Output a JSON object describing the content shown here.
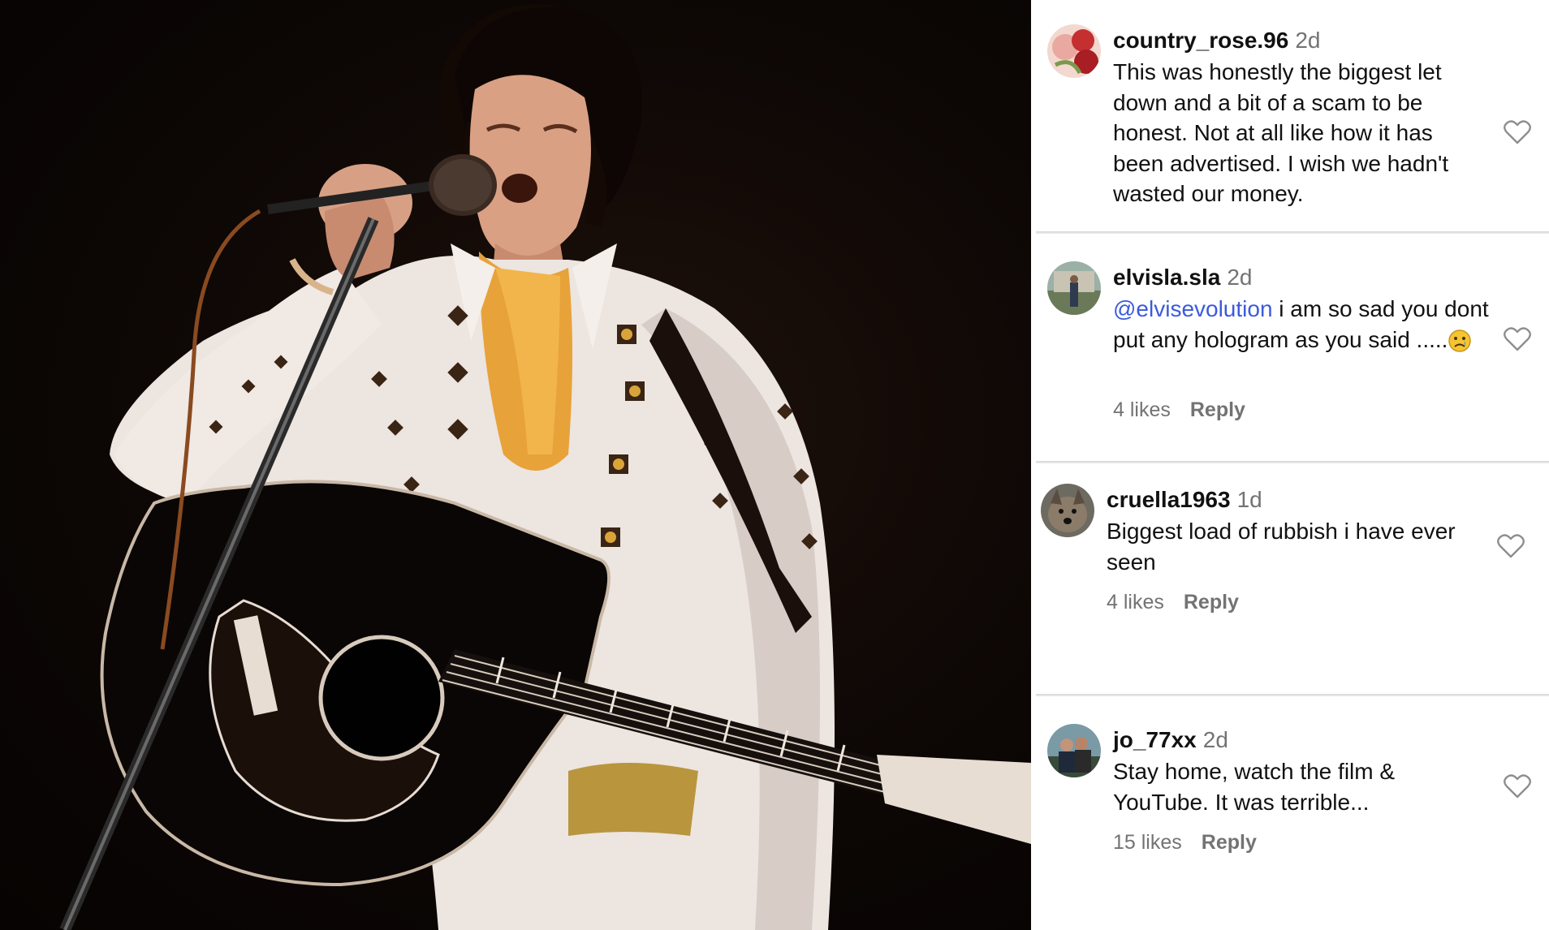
{
  "photo": {
    "subject": "concert-photo"
  },
  "comments": [
    {
      "username": "country_rose.96",
      "time": "2d",
      "text": "This was honestly the biggest let down and a bit of a scam to be honest. Not at all like how it has been advertised. I wish we hadn't wasted our money.",
      "likes": "",
      "reply": ""
    },
    {
      "username": "elvisla.sla",
      "time": "2d",
      "mention": "@elvisevolution",
      "text": " i am so sad you dont put any hologram as you said .....",
      "emoji": "sad-face-emoji",
      "likes": "4 likes",
      "reply": "Reply"
    },
    {
      "username": "cruella1963",
      "time": "1d",
      "text": "Biggest load of rubbish i have ever seen",
      "likes": "4 likes",
      "reply": "Reply"
    },
    {
      "username": "jo_77xx",
      "time": "2d",
      "text": "Stay home, watch the film & YouTube. It was terrible...",
      "likes": "15 likes",
      "reply": "Reply"
    }
  ],
  "colors": {
    "username": "#111111",
    "muted": "#737373",
    "mention": "#3b5bdb",
    "background": "#ffffff"
  }
}
